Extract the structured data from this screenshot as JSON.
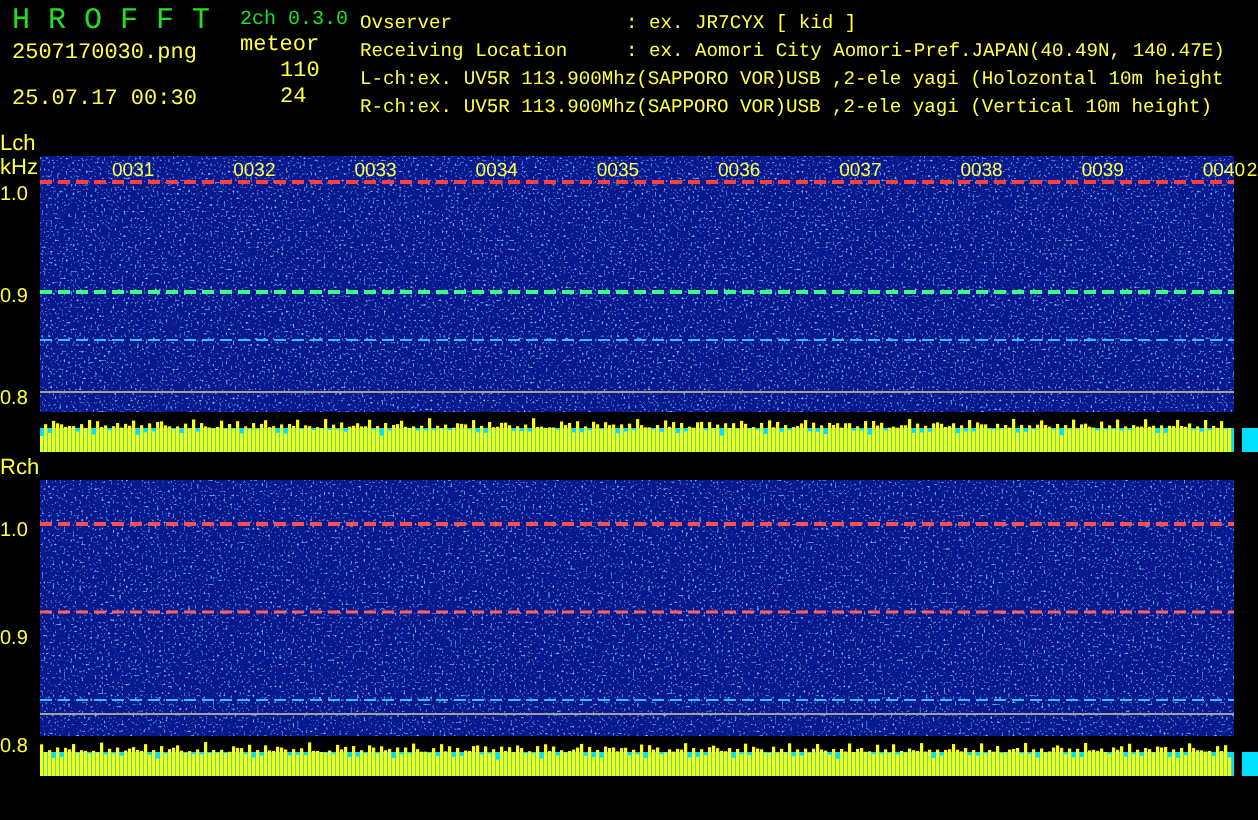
{
  "app": {
    "title": "H R O F F T",
    "version": "2ch 0.3.0",
    "filename": "2507170030.png",
    "datetime": "25.07.17 00:30",
    "meteor_label": "meteor",
    "counts": [
      "110",
      "24"
    ]
  },
  "info_lines": [
    {
      "kind": "pair",
      "label": "Ovserver",
      "value": ": ex. JR7CYX [ kid ]"
    },
    {
      "kind": "pair",
      "label": "Receiving Location",
      "value": ": ex. Aomori City Aomori-Pref.JAPAN(40.49N, 140.47E)"
    },
    {
      "kind": "line",
      "text": "L-ch:ex. UV5R 113.900Mhz(SAPPORO VOR)USB ,2-ele yagi (Holozontal 10m height"
    },
    {
      "kind": "line",
      "text": "R-ch:ex. UV5R 113.900Mhz(SAPPORO VOR)USB ,2-ele yagi (Vertical 10m height)"
    }
  ],
  "panels": [
    {
      "label": "Lch",
      "unit": "kHz",
      "yticks": [
        "1.0",
        "0.9",
        "0.8"
      ],
      "time_labels": [
        "0031",
        "0032",
        "0033",
        "0034",
        "0035",
        "0036",
        "0037",
        "0038",
        "0039",
        "0040",
        "2"
      ]
    },
    {
      "label": "Rch",
      "yticks": [
        "1.0",
        "0.9",
        "0.8"
      ]
    }
  ]
}
